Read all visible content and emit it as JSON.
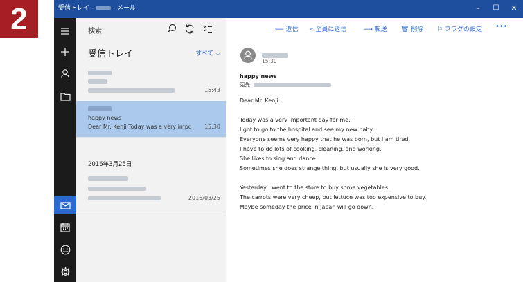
{
  "step_number": "2",
  "window": {
    "title_prefix": "受信トレイ - ",
    "title_suffix": " - メール",
    "controls": {
      "minimize": "–",
      "maximize": "☐",
      "close": "✕"
    }
  },
  "nav_rail": [
    "hamburger-icon",
    "compose-icon",
    "account-icon",
    "folder-icon",
    "mail-icon",
    "calendar-icon",
    "feedback-icon",
    "settings-icon"
  ],
  "list": {
    "search_label": "検索",
    "folder_name": "受信トレイ",
    "filter_label": "すべて ⌵",
    "messages": [
      {
        "time": "15:43"
      },
      {
        "subject": "happy news",
        "preview": "Dear Mr. Kenji Today was a very impc",
        "time": "15:30"
      },
      {
        "time": "2016/03/25"
      }
    ],
    "date_group": "2016年3月25日"
  },
  "toolbar": {
    "reply": "返信",
    "reply_all": "全員に返信",
    "forward": "転送",
    "delete": "削除",
    "flag": "フラグの設定",
    "more": "•••"
  },
  "email": {
    "time": "15:30",
    "subject": "happy news",
    "to_label": "宛先:",
    "body": [
      "Dear Mr. Kenji",
      "",
      "Today was a very important day for me.",
      "I got to go to the hospital and see my new baby.",
      "Everyone seems very happy that he was born, but I am tired.",
      "I have to do lots of cooking, cleaning, and working.",
      "She likes to sing and dance.",
      "Sometimes she does strange thing, but usually she is very good.",
      "",
      "Yesterday I went to the store to buy some vegetables.",
      "The carrots were very cheep, but lettuce was too expensive to buy.",
      "Maybe someday the price in Japan will go down."
    ]
  },
  "colors": {
    "accent": "#2b6bd0",
    "titlebar": "#1e4e9e",
    "selected": "#aac9ed",
    "step_badge": "#a61f24"
  }
}
